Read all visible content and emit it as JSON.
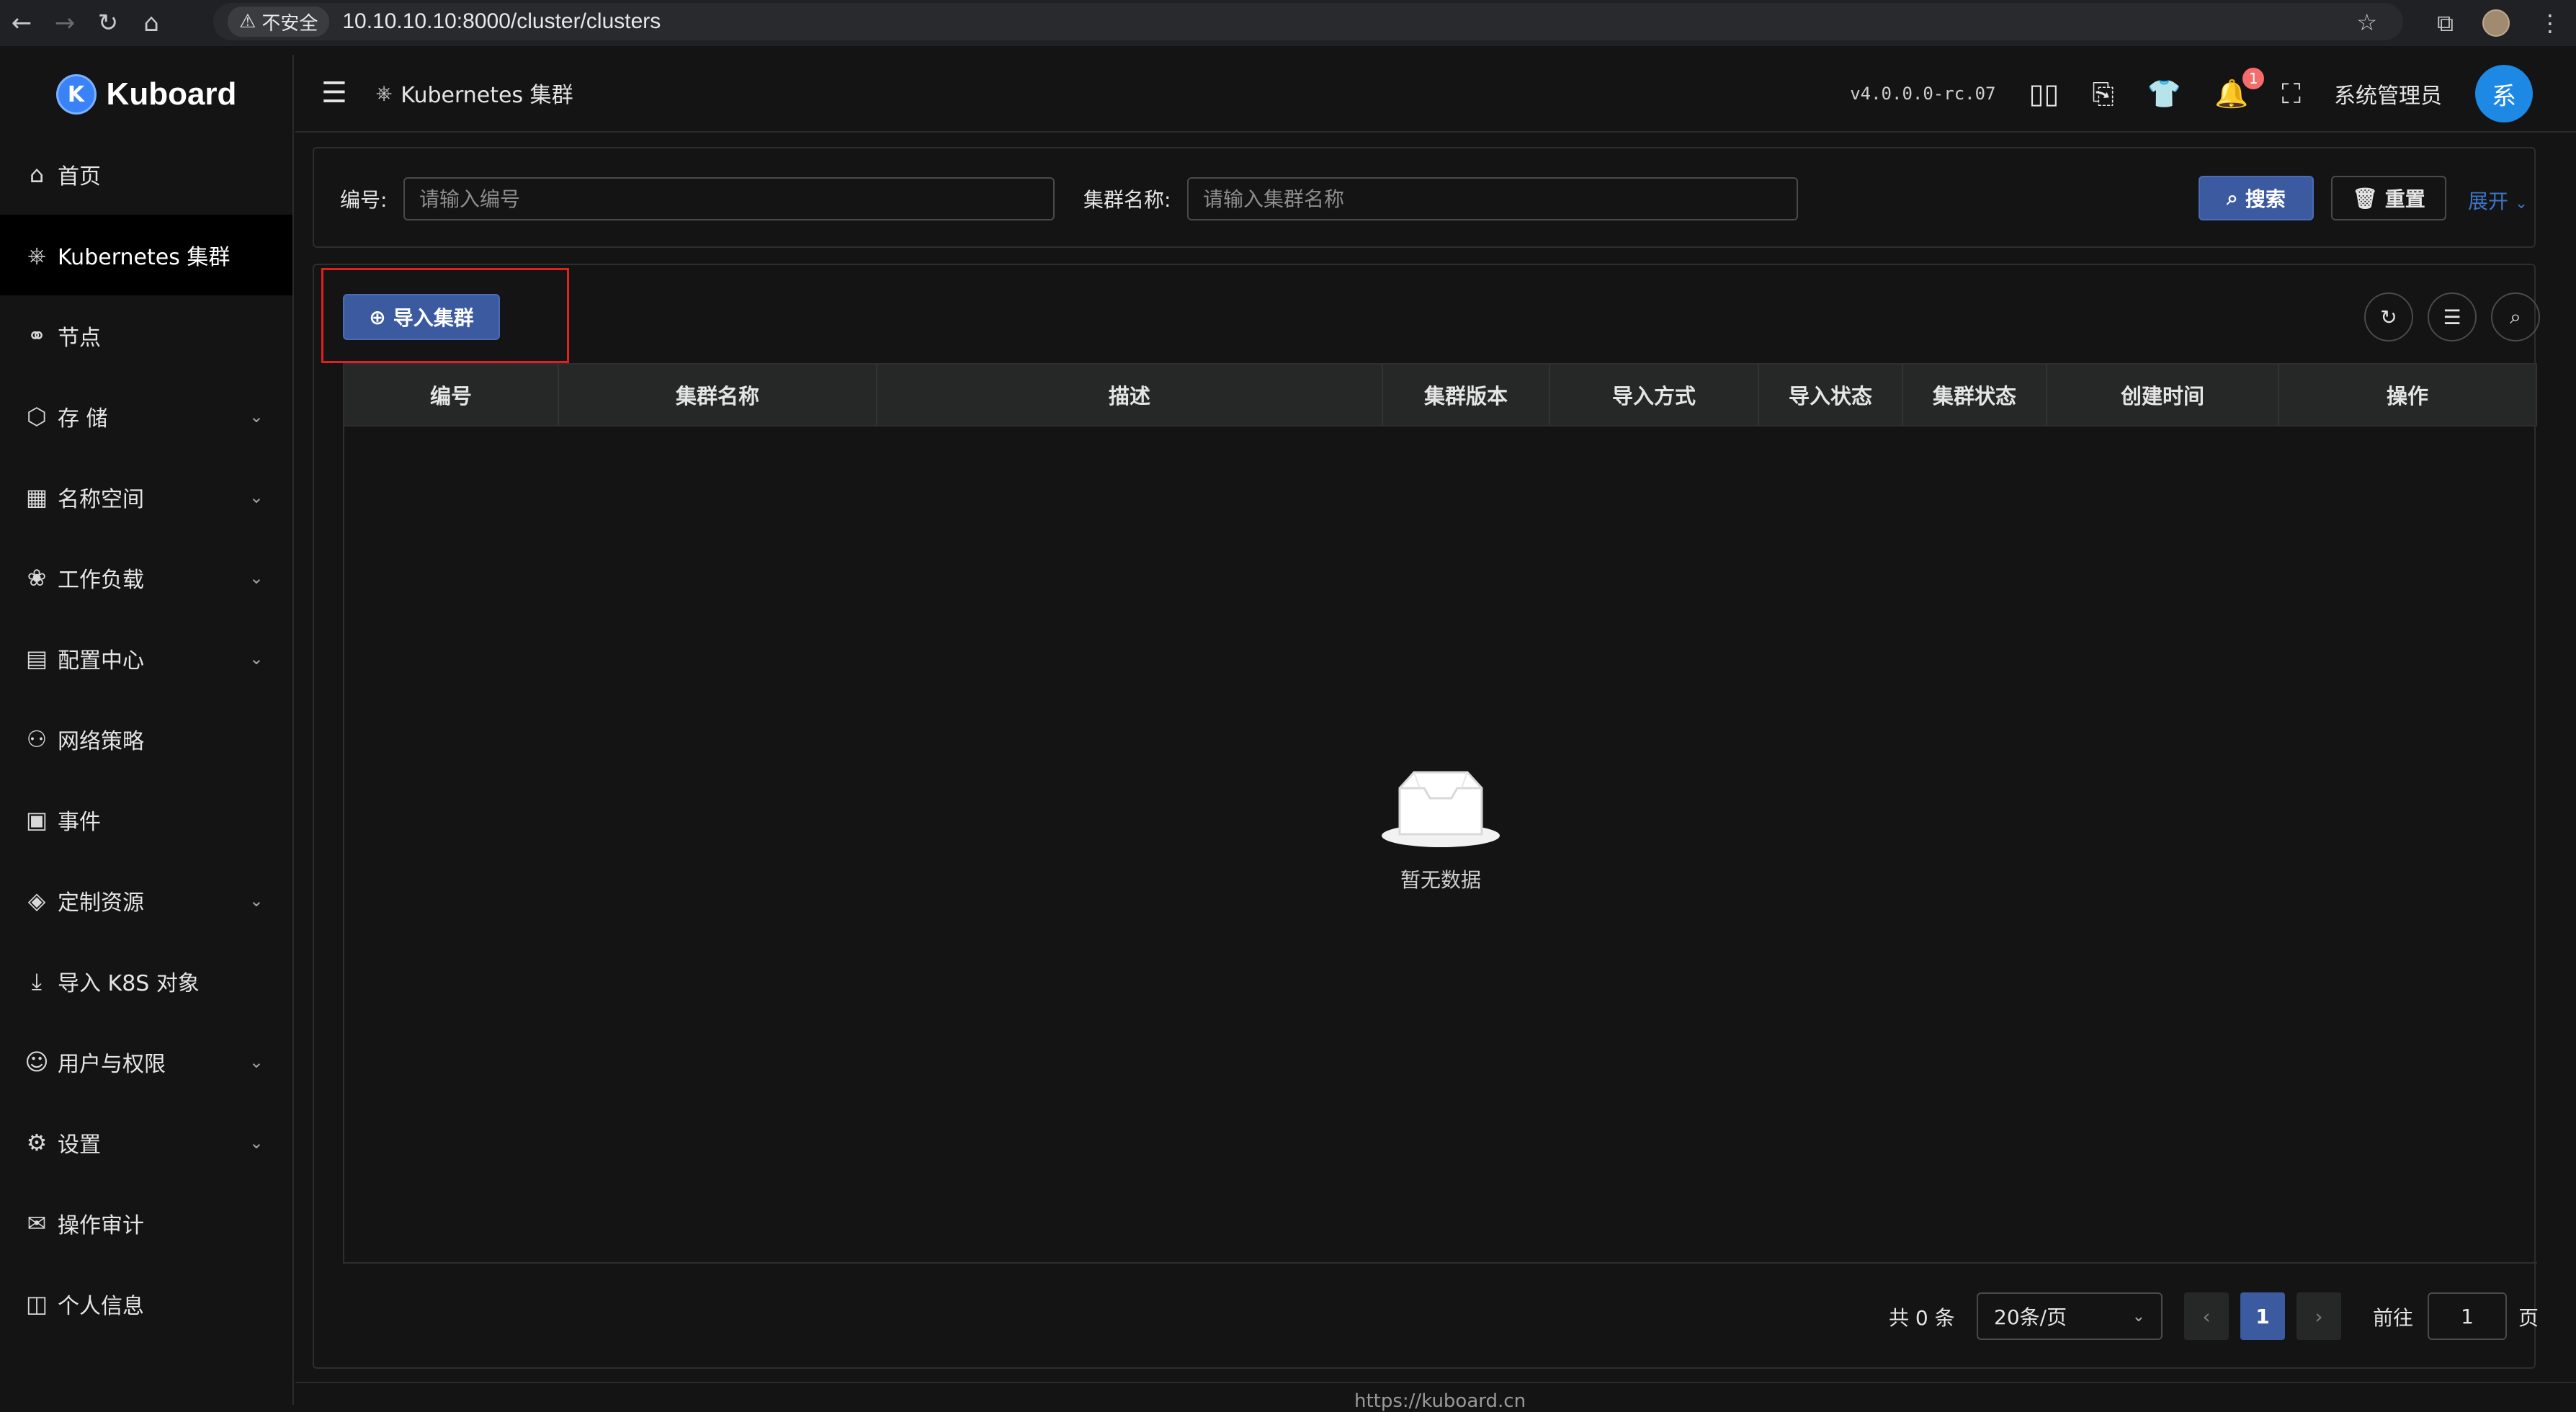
{
  "browser": {
    "back_icon": "←",
    "forward_icon": "→",
    "reload_icon": "↻",
    "home_icon": "⌂",
    "insecure_label": "不安全",
    "url": "10.10.10.10:8000/cluster/clusters"
  },
  "sidebar": {
    "logo_letter": "K",
    "logo_text": "Kuboard",
    "items": [
      {
        "label": "首页",
        "icon": "⌂",
        "has_children": false,
        "active": false
      },
      {
        "label": "Kubernetes 集群",
        "icon": "⎈",
        "has_children": false,
        "active": true
      },
      {
        "label": "节点",
        "icon": "⚭",
        "has_children": false,
        "active": false
      },
      {
        "label": "存 储",
        "icon": "⬡",
        "has_children": true,
        "active": false
      },
      {
        "label": "名称空间",
        "icon": "▦",
        "has_children": true,
        "active": false
      },
      {
        "label": "工作负载",
        "icon": "❀",
        "has_children": true,
        "active": false
      },
      {
        "label": "配置中心",
        "icon": "▤",
        "has_children": true,
        "active": false
      },
      {
        "label": "网络策略",
        "icon": "⚇",
        "has_children": false,
        "active": false
      },
      {
        "label": "事件",
        "icon": "▣",
        "has_children": false,
        "active": false
      },
      {
        "label": "定制资源",
        "icon": "◈",
        "has_children": true,
        "active": false
      },
      {
        "label": "导入 K8S 对象",
        "icon": "⤓",
        "has_children": false,
        "active": false
      },
      {
        "label": "用户与权限",
        "icon": "☺",
        "has_children": true,
        "active": false
      },
      {
        "label": "设置",
        "icon": "⚙",
        "has_children": true,
        "active": false
      },
      {
        "label": "操作审计",
        "icon": "✉",
        "has_children": false,
        "active": false
      },
      {
        "label": "个人信息",
        "icon": "◫",
        "has_children": false,
        "active": false
      }
    ]
  },
  "header": {
    "breadcrumb": "Kubernetes 集群",
    "version": "v4.0.0.0-rc.07",
    "notification_count": "1",
    "username": "系统管理员",
    "avatar_text": "系"
  },
  "search": {
    "id_label": "编号:",
    "id_placeholder": "请输入编号",
    "name_label": "集群名称:",
    "name_placeholder": "请输入集群名称",
    "search_button": "搜索",
    "reset_button": "重置",
    "expand_link": "展开"
  },
  "table": {
    "import_button": "导入集群",
    "columns": [
      "编号",
      "集群名称",
      "描述",
      "集群版本",
      "导入方式",
      "导入状态",
      "集群状态",
      "创建时间",
      "操作"
    ],
    "empty_text": "暂无数据"
  },
  "pagination": {
    "total": "共 0 条",
    "page_size": "20条/页",
    "current_page": "1",
    "goto_label": "前往",
    "goto_value": "1",
    "page_suffix": "页"
  },
  "footer": {
    "text": "https://kuboard.cn"
  },
  "colors": {
    "accent": "#3b5aa0",
    "highlight": "#e02020",
    "avatar": "#1e88e5"
  }
}
